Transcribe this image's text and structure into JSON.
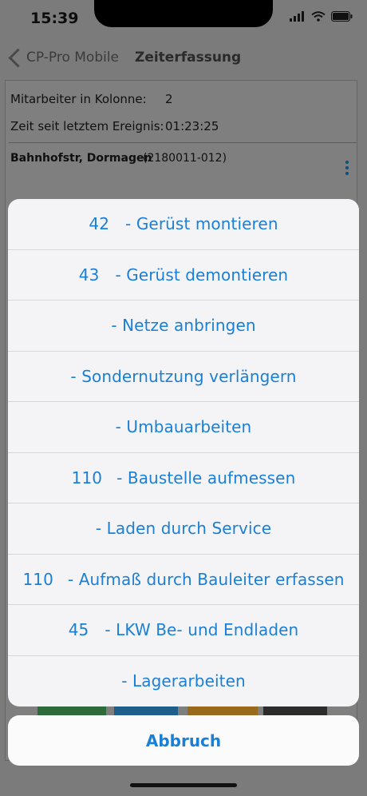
{
  "status_bar": {
    "time": "15:39"
  },
  "nav": {
    "back_label": "CP-Pro Mobile",
    "title": "Zeiterfassung"
  },
  "info": {
    "crew_label": "Mitarbeiter in Kolonne:",
    "crew_value": "2",
    "elapsed_label": "Zeit seit letztem Ereignis:",
    "elapsed_value": "01:23:25"
  },
  "site": {
    "name": "Bahnhofstr, Dormagen",
    "code": "(2180011-012)"
  },
  "action_sheet": {
    "items": [
      {
        "num": "42",
        "label": "- Gerüst montieren"
      },
      {
        "num": "43",
        "label": "- Gerüst demontieren"
      },
      {
        "num": "",
        "label": "- Netze anbringen"
      },
      {
        "num": "",
        "label": "- Sondernutzung verlängern"
      },
      {
        "num": "",
        "label": "- Umbauarbeiten"
      },
      {
        "num": "110",
        "label": "- Baustelle aufmessen"
      },
      {
        "num": "",
        "label": "- Laden durch Service"
      },
      {
        "num": "110",
        "label": "- Aufmaß durch Bauleiter erfassen"
      },
      {
        "num": "45",
        "label": "- LKW Be- und Endladen"
      },
      {
        "num": "",
        "label": "- Lagerarbeiten"
      }
    ],
    "cancel_label": "Abbruch"
  },
  "colors": {
    "accent": "#1a7fd6",
    "dim_background": "#7b7b7b",
    "sheet_background": "#f4f4f6"
  }
}
